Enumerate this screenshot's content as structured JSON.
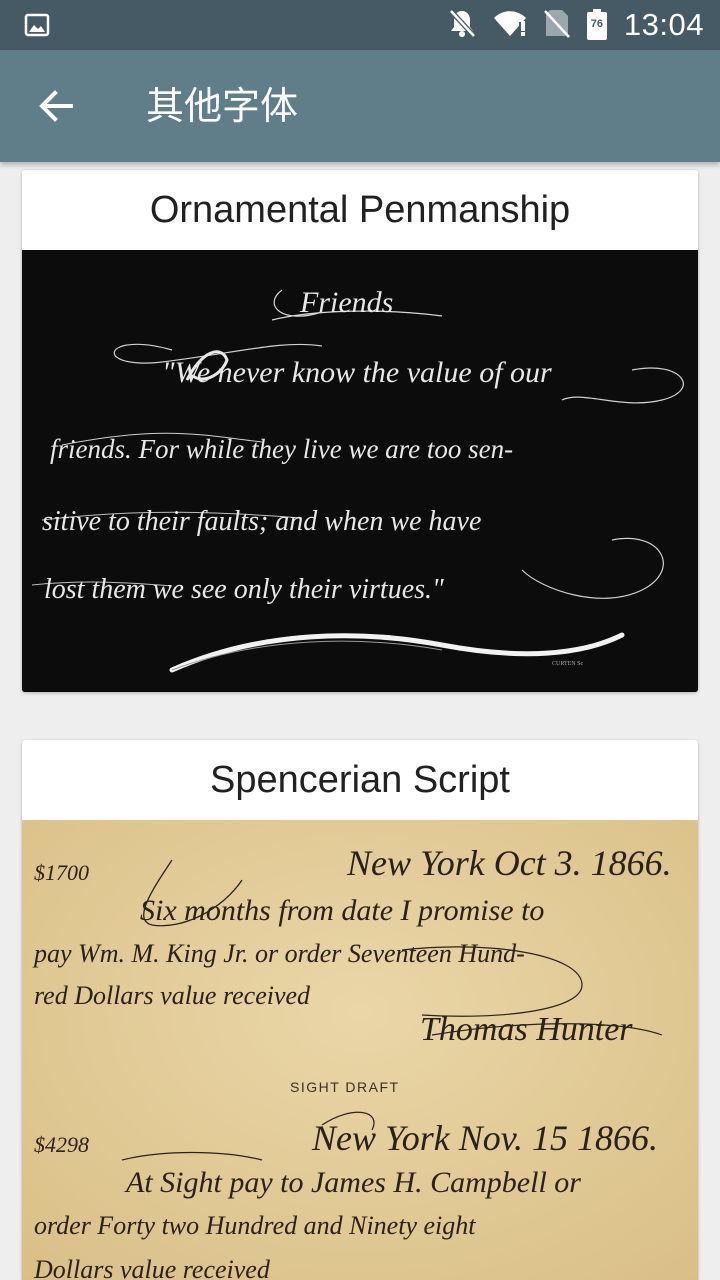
{
  "status_bar": {
    "time": "13:04",
    "battery_level": "76",
    "icons": [
      "image-notification-icon",
      "notifications-off-icon",
      "wifi-icon",
      "no-sim-icon",
      "battery-icon"
    ]
  },
  "app_bar": {
    "title": "其他字体",
    "back_icon": "arrow-left-icon"
  },
  "fonts": [
    {
      "title": "Ornamental Penmanship",
      "image_text": [
        "Friends",
        "\"We never know the value of our",
        "friends. For while they live we are too sen-",
        "sitive to their faults; and when we have",
        "lost them we see only their virtues.\""
      ]
    },
    {
      "title": "Spencerian Script",
      "image_text": [
        "$1700",
        "New York Oct 3. 1866.",
        "Six months from date I promise to",
        "pay Wm. M. King Jr. or order Seventeen Hund-",
        "red Dollars value received",
        "Thomas Hunter",
        "SIGHT DRAFT",
        "$4298",
        "New York Nov. 15 1866.",
        "At Sight pay to James H. Campbell or",
        "order Forty two Hundred and Ninety eight",
        "Dollars value received"
      ]
    }
  ],
  "colors": {
    "status_bar": "#455a64",
    "app_bar": "#5f7e8a",
    "background": "#eeeeee",
    "card": "#ffffff",
    "parchment": "#e3cc9a"
  }
}
